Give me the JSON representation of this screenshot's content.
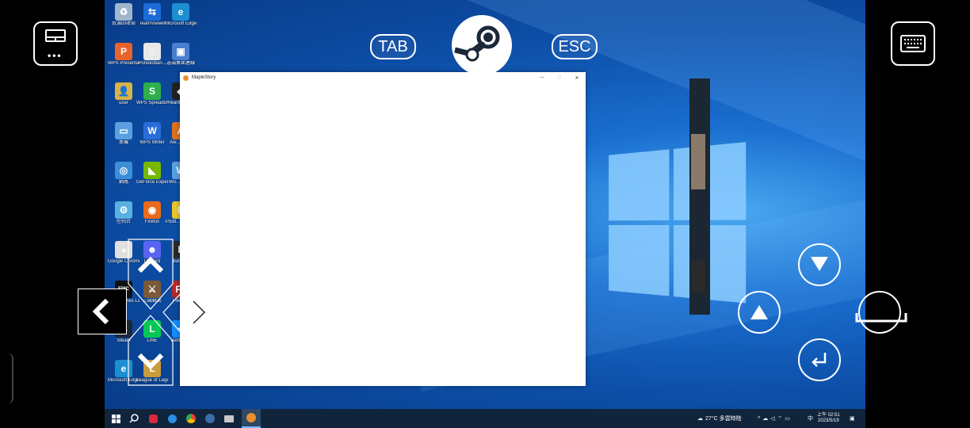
{
  "desktop_icons": [
    {
      "label": "資源回收筒",
      "color": "#9fb6cc",
      "glyph": "♻"
    },
    {
      "label": "TeamViewer",
      "color": "#1c6cd8",
      "glyph": "⇆"
    },
    {
      "label": "Microsoft Edge",
      "color": "#1c8fd0",
      "glyph": "e"
    },
    {
      "label": "WPS Presentation",
      "color": "#e8632b",
      "glyph": "P"
    },
    {
      "label": "Ponokoban...",
      "color": "#e8e8e8",
      "glyph": "☺"
    },
    {
      "label": "遠端桌面連線",
      "color": "#4a7fd0",
      "glyph": "▣"
    },
    {
      "label": "user",
      "color": "#d8b34a",
      "glyph": "👤"
    },
    {
      "label": "WPS Spreadshe...",
      "color": "#2fae4e",
      "glyph": "S"
    },
    {
      "label": "Hearth Deck",
      "color": "#222222",
      "glyph": "◆"
    },
    {
      "label": "本機",
      "color": "#5aa0e0",
      "glyph": "▭"
    },
    {
      "label": "WPS Writer",
      "color": "#2a6dd8",
      "glyph": "W"
    },
    {
      "label": "Aw... Artist",
      "color": "#e07020",
      "glyph": "A"
    },
    {
      "label": "網路",
      "color": "#3a8fd8",
      "glyph": "◎"
    },
    {
      "label": "GeForce Experience",
      "color": "#76b900",
      "glyph": "◣"
    },
    {
      "label": "Wo... Onl...",
      "color": "#5aa0e0",
      "glyph": "W"
    },
    {
      "label": "控制台",
      "color": "#5ab0e0",
      "glyph": "⚙"
    },
    {
      "label": "Firefox",
      "color": "#e86a1a",
      "glyph": "◉"
    },
    {
      "label": "Postl... Sticker",
      "color": "#e8c52a",
      "glyph": "P"
    },
    {
      "label": "Google Chrome",
      "color": "#e0e0e0",
      "glyph": "◕"
    },
    {
      "label": "Discord",
      "color": "#5865f2",
      "glyph": "☻"
    },
    {
      "label": "Battle...",
      "color": "#2a2a2a",
      "glyph": "b"
    },
    {
      "label": "Epic Games Launcher",
      "color": "#111111",
      "glyph": "EPIC"
    },
    {
      "label": "三國群英",
      "color": "#7a5a3a",
      "glyph": "⚔"
    },
    {
      "label": "FileZilla",
      "color": "#b22a2a",
      "glyph": "Fz"
    },
    {
      "label": "Steam",
      "color": "#1b2838",
      "glyph": "♨"
    },
    {
      "label": "LINE",
      "color": "#06c755",
      "glyph": "L"
    },
    {
      "label": "Battle.net",
      "color": "#148eff",
      "glyph": "✦"
    },
    {
      "label": "Microsoft Edge",
      "color": "#1c8fd0",
      "glyph": "e"
    },
    {
      "label": "League of Legends",
      "color": "#c89b3c",
      "glyph": "L"
    }
  ],
  "window": {
    "title": "MapleStory",
    "min": "—",
    "max": "□",
    "close": "✕"
  },
  "overlay": {
    "tab_label": "TAB",
    "esc_label": "ESC"
  },
  "taskbar": {
    "icons": [
      "start-icon",
      "search-icon",
      "video-icon",
      "battle-icon",
      "chrome-icon",
      "steam-icon",
      "explorer-icon",
      "maplestory-icon"
    ],
    "weather": "27°C 多雲時陰",
    "ime": "中",
    "time": "上午 02:51",
    "date": "2023/5/19"
  }
}
